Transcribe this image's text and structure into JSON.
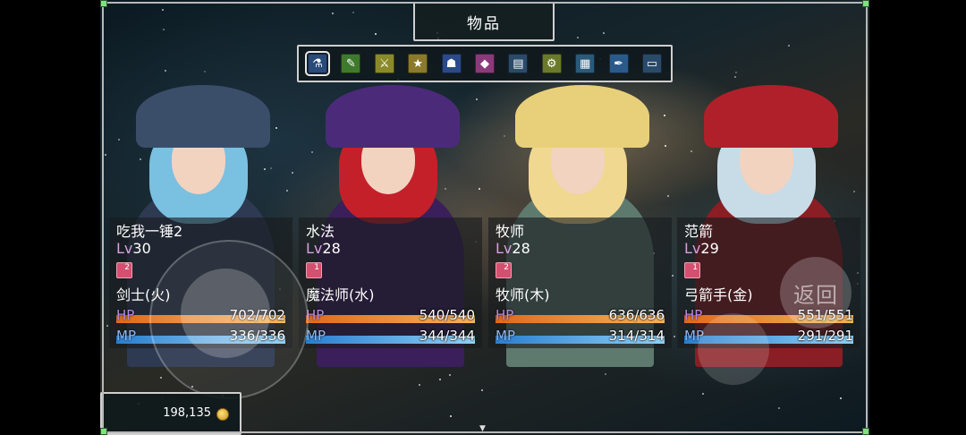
{
  "window": {
    "title": "物品"
  },
  "toolbar": {
    "icons": [
      {
        "name": "potion-icon",
        "glyph": "⚗",
        "color": "#2a4a7a",
        "active": true
      },
      {
        "name": "scroll-icon",
        "glyph": "✎",
        "color": "#3f7a2c",
        "active": false
      },
      {
        "name": "sword-icon",
        "glyph": "⚔",
        "color": "#8a8a2a",
        "active": false
      },
      {
        "name": "star-icon",
        "glyph": "★",
        "color": "#8a7a2a",
        "active": false
      },
      {
        "name": "running-figure-icon",
        "glyph": "☗",
        "color": "#2a4a8a",
        "active": false
      },
      {
        "name": "crystal-icon",
        "glyph": "◆",
        "color": "#8a3a7a",
        "active": false
      },
      {
        "name": "book-icon",
        "glyph": "▤",
        "color": "#2a4a6a",
        "active": false
      },
      {
        "name": "gear-icon",
        "glyph": "⚙",
        "color": "#6a7a2a",
        "active": false
      },
      {
        "name": "card-icon",
        "glyph": "▦",
        "color": "#2a5a7a",
        "active": false
      },
      {
        "name": "feather-icon",
        "glyph": "✒",
        "color": "#2a5a8a",
        "active": false
      },
      {
        "name": "monitor-icon",
        "glyph": "▭",
        "color": "#2a4a6a",
        "active": false
      }
    ]
  },
  "party": [
    {
      "name": "吃我一锤2",
      "lv_label": "Lv",
      "lv": "30",
      "badge": "2",
      "class": "剑士(火)",
      "hp_label": "HP",
      "hp": "702/702",
      "hp_ratio": 1.0,
      "mp_label": "MP",
      "mp": "336/336",
      "mp_ratio": 1.0,
      "colors": {
        "hat": "#3a4e6a",
        "hair": "#7ac0e0",
        "body": "#2e3a52"
      }
    },
    {
      "name": "水法",
      "lv_label": "Lv",
      "lv": "28",
      "badge": "1",
      "class": "魔法师(水)",
      "hp_label": "HP",
      "hp": "540/540",
      "hp_ratio": 1.0,
      "mp_label": "MP",
      "mp": "344/344",
      "mp_ratio": 1.0,
      "colors": {
        "hat": "#4b2a7a",
        "hair": "#c4202a",
        "body": "#3a1f5a"
      }
    },
    {
      "name": "牧师",
      "lv_label": "Lv",
      "lv": "28",
      "badge": "2",
      "class": "牧师(木)",
      "hp_label": "HP",
      "hp": "636/636",
      "hp_ratio": 1.0,
      "mp_label": "MP",
      "mp": "314/314",
      "mp_ratio": 1.0,
      "colors": {
        "hat": "#e8d07a",
        "hair": "#f0d890",
        "body": "#5e7a6e"
      }
    },
    {
      "name": "范箭",
      "lv_label": "Lv",
      "lv": "29",
      "badge": "1",
      "class": "弓箭手(金)",
      "hp_label": "HP",
      "hp": "551/551",
      "hp_ratio": 1.0,
      "mp_label": "MP",
      "mp": "291/291",
      "mp_ratio": 1.0,
      "colors": {
        "hat": "#b0202a",
        "hair": "#c8dce8",
        "body": "#8a1e24"
      }
    }
  ],
  "controls": {
    "back_label": "返回"
  },
  "gold": {
    "amount": "198,135"
  }
}
